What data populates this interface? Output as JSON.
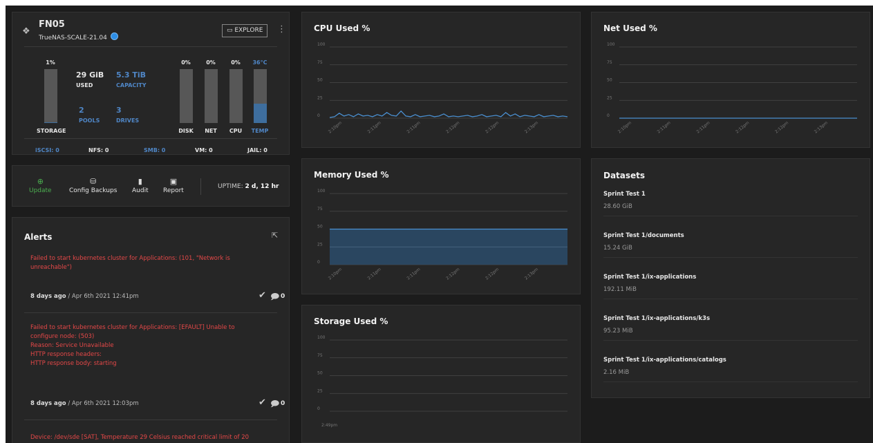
{
  "system": {
    "hostname": "FN05",
    "version": "TrueNAS-SCALE-21.04",
    "explore_label": "EXPLORE",
    "storage": {
      "pct_label": "1%",
      "fill_pct": 1,
      "label": "STORAGE"
    },
    "used_value": "29 GiB",
    "used_label": "USED",
    "capacity_value": "5.3 TiB",
    "capacity_label": "CAPACITY",
    "pools_value": "2",
    "pools_label": "POOLS",
    "drives_value": "3",
    "drives_label": "DRIVES",
    "meters": [
      {
        "label": "DISK",
        "pct_label": "0%",
        "fill_pct": 0
      },
      {
        "label": "NET",
        "pct_label": "0%",
        "fill_pct": 0
      },
      {
        "label": "CPU",
        "pct_label": "0%",
        "fill_pct": 0
      },
      {
        "label": "TEMP",
        "pct_label": "36°C",
        "fill_pct": 36
      }
    ],
    "shares": [
      {
        "text": "iSCSI: 0",
        "highlight": true
      },
      {
        "text": "NFS: 0",
        "highlight": false
      },
      {
        "text": "SMB: 0",
        "highlight": true
      },
      {
        "text": "VM: 0",
        "highlight": false
      },
      {
        "text": "JAIL: 0",
        "highlight": false
      }
    ]
  },
  "actions": {
    "update": "Update",
    "config_backups": "Config Backups",
    "audit": "Audit",
    "report": "Report",
    "uptime_label": "UPTIME:",
    "uptime_value": "2 d, 12 hr"
  },
  "alerts": {
    "title": "Alerts",
    "items": [
      {
        "lines": [
          "Failed to start kubernetes cluster for Applications: (101, \"Network is",
          "unreachable\")"
        ],
        "ago": "8 days ago",
        "date": "/ Apr 6th 2021 12:41pm",
        "count": "0"
      },
      {
        "lines": [
          "Failed to start kubernetes cluster for Applications: [EFAULT] Unable to",
          "configure node: (503)",
          "Reason: Service Unavailable",
          "HTTP response headers:",
          "HTTP response body: starting"
        ],
        "ago": "8 days ago",
        "date": "/ Apr 6th 2021 12:03pm",
        "count": "0"
      },
      {
        "lines": [
          "Device: /dev/sde [SAT], Temperature 29 Celsius reached critical limit of 20"
        ],
        "ago": "",
        "date": "",
        "count": ""
      }
    ]
  },
  "colors": {
    "accent": "#4f86c6",
    "alert": "#e54848",
    "update": "#4caf50",
    "series": "#4a8fd0"
  },
  "chart_data": [
    {
      "type": "line",
      "title": "CPU Used %",
      "ylim": [
        0,
        100
      ],
      "yticks": [
        "100",
        "75",
        "50",
        "25",
        "0"
      ],
      "x_tick_labels": [
        "2:10pm",
        "2:11pm",
        "2:11pm",
        "2:12pm",
        "2:12pm",
        "2:13pm"
      ],
      "series": [
        {
          "values": [
            1,
            2,
            7,
            3,
            5,
            2,
            6,
            3,
            4,
            2,
            5,
            3,
            8,
            4,
            3,
            10,
            3,
            2,
            5,
            2,
            3,
            4,
            2,
            3,
            6,
            2,
            3,
            2,
            3,
            4,
            2,
            3,
            5,
            2,
            3,
            4,
            2,
            8,
            3,
            6,
            2,
            4,
            3,
            2,
            5,
            2,
            3,
            4,
            2,
            3,
            2
          ]
        }
      ]
    },
    {
      "type": "line",
      "title": "Net Used %",
      "ylim": [
        0,
        100
      ],
      "yticks": [
        "100",
        "75",
        "50",
        "25",
        "0"
      ],
      "x_tick_labels": [
        "2:10pm",
        "2:11pm",
        "2:11pm",
        "2:12pm",
        "2:12pm",
        "2:13pm"
      ],
      "series": [
        {
          "values": [
            0,
            0,
            0,
            0,
            0,
            0,
            0,
            0,
            0,
            0,
            0,
            0
          ]
        }
      ]
    },
    {
      "type": "area",
      "title": "Memory Used %",
      "ylim": [
        0,
        100
      ],
      "yticks": [
        "100",
        "75",
        "50",
        "25",
        "0"
      ],
      "x_tick_labels": [
        "2:10pm",
        "2:11pm",
        "2:11pm",
        "2:12pm",
        "2:12pm",
        "2:13pm"
      ],
      "series": [
        {
          "values": [
            50,
            50,
            50,
            50,
            50,
            50,
            50,
            50,
            50,
            50,
            50,
            50
          ]
        }
      ]
    },
    {
      "type": "line",
      "title": "Storage Used %",
      "ylim": [
        0,
        100
      ],
      "yticks": [
        "100",
        "75",
        "50",
        "25",
        "0"
      ],
      "x_tick_labels": [
        "2:49pm"
      ],
      "series": [
        {
          "values": []
        }
      ]
    }
  ],
  "datasets": {
    "title": "Datasets",
    "items": [
      {
        "name": "Sprint Test 1",
        "size": "28.60 GiB"
      },
      {
        "name": "Sprint Test 1/documents",
        "size": "15.24 GiB"
      },
      {
        "name": "Sprint Test 1/ix-applications",
        "size": "192.11 MiB"
      },
      {
        "name": "Sprint Test 1/ix-applications/k3s",
        "size": "95.23 MiB"
      },
      {
        "name": "Sprint Test 1/ix-applications/catalogs",
        "size": "2.16 MiB"
      }
    ]
  }
}
